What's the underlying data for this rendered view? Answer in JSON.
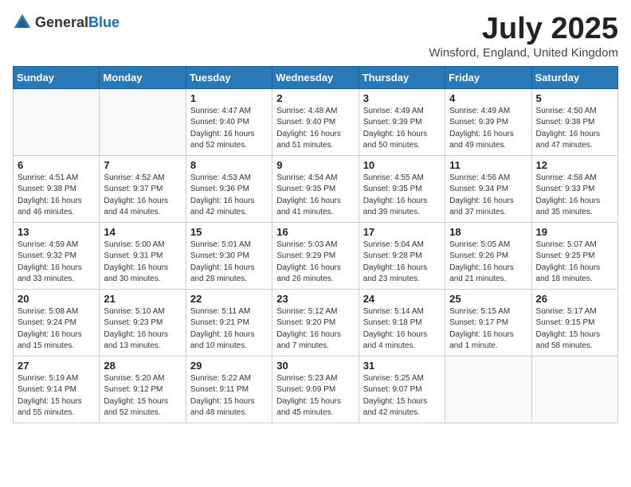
{
  "header": {
    "logo_general": "General",
    "logo_blue": "Blue",
    "title": "July 2025",
    "location": "Winsford, England, United Kingdom"
  },
  "days_of_week": [
    "Sunday",
    "Monday",
    "Tuesday",
    "Wednesday",
    "Thursday",
    "Friday",
    "Saturday"
  ],
  "weeks": [
    [
      {
        "day": "",
        "info": ""
      },
      {
        "day": "",
        "info": ""
      },
      {
        "day": "1",
        "info": "Sunrise: 4:47 AM\nSunset: 9:40 PM\nDaylight: 16 hours and 52 minutes."
      },
      {
        "day": "2",
        "info": "Sunrise: 4:48 AM\nSunset: 9:40 PM\nDaylight: 16 hours and 51 minutes."
      },
      {
        "day": "3",
        "info": "Sunrise: 4:49 AM\nSunset: 9:39 PM\nDaylight: 16 hours and 50 minutes."
      },
      {
        "day": "4",
        "info": "Sunrise: 4:49 AM\nSunset: 9:39 PM\nDaylight: 16 hours and 49 minutes."
      },
      {
        "day": "5",
        "info": "Sunrise: 4:50 AM\nSunset: 9:38 PM\nDaylight: 16 hours and 47 minutes."
      }
    ],
    [
      {
        "day": "6",
        "info": "Sunrise: 4:51 AM\nSunset: 9:38 PM\nDaylight: 16 hours and 46 minutes."
      },
      {
        "day": "7",
        "info": "Sunrise: 4:52 AM\nSunset: 9:37 PM\nDaylight: 16 hours and 44 minutes."
      },
      {
        "day": "8",
        "info": "Sunrise: 4:53 AM\nSunset: 9:36 PM\nDaylight: 16 hours and 42 minutes."
      },
      {
        "day": "9",
        "info": "Sunrise: 4:54 AM\nSunset: 9:35 PM\nDaylight: 16 hours and 41 minutes."
      },
      {
        "day": "10",
        "info": "Sunrise: 4:55 AM\nSunset: 9:35 PM\nDaylight: 16 hours and 39 minutes."
      },
      {
        "day": "11",
        "info": "Sunrise: 4:56 AM\nSunset: 9:34 PM\nDaylight: 16 hours and 37 minutes."
      },
      {
        "day": "12",
        "info": "Sunrise: 4:58 AM\nSunset: 9:33 PM\nDaylight: 16 hours and 35 minutes."
      }
    ],
    [
      {
        "day": "13",
        "info": "Sunrise: 4:59 AM\nSunset: 9:32 PM\nDaylight: 16 hours and 33 minutes."
      },
      {
        "day": "14",
        "info": "Sunrise: 5:00 AM\nSunset: 9:31 PM\nDaylight: 16 hours and 30 minutes."
      },
      {
        "day": "15",
        "info": "Sunrise: 5:01 AM\nSunset: 9:30 PM\nDaylight: 16 hours and 28 minutes."
      },
      {
        "day": "16",
        "info": "Sunrise: 5:03 AM\nSunset: 9:29 PM\nDaylight: 16 hours and 26 minutes."
      },
      {
        "day": "17",
        "info": "Sunrise: 5:04 AM\nSunset: 9:28 PM\nDaylight: 16 hours and 23 minutes."
      },
      {
        "day": "18",
        "info": "Sunrise: 5:05 AM\nSunset: 9:26 PM\nDaylight: 16 hours and 21 minutes."
      },
      {
        "day": "19",
        "info": "Sunrise: 5:07 AM\nSunset: 9:25 PM\nDaylight: 16 hours and 18 minutes."
      }
    ],
    [
      {
        "day": "20",
        "info": "Sunrise: 5:08 AM\nSunset: 9:24 PM\nDaylight: 16 hours and 15 minutes."
      },
      {
        "day": "21",
        "info": "Sunrise: 5:10 AM\nSunset: 9:23 PM\nDaylight: 16 hours and 13 minutes."
      },
      {
        "day": "22",
        "info": "Sunrise: 5:11 AM\nSunset: 9:21 PM\nDaylight: 16 hours and 10 minutes."
      },
      {
        "day": "23",
        "info": "Sunrise: 5:12 AM\nSunset: 9:20 PM\nDaylight: 16 hours and 7 minutes."
      },
      {
        "day": "24",
        "info": "Sunrise: 5:14 AM\nSunset: 9:18 PM\nDaylight: 16 hours and 4 minutes."
      },
      {
        "day": "25",
        "info": "Sunrise: 5:15 AM\nSunset: 9:17 PM\nDaylight: 16 hours and 1 minute."
      },
      {
        "day": "26",
        "info": "Sunrise: 5:17 AM\nSunset: 9:15 PM\nDaylight: 15 hours and 58 minutes."
      }
    ],
    [
      {
        "day": "27",
        "info": "Sunrise: 5:19 AM\nSunset: 9:14 PM\nDaylight: 15 hours and 55 minutes."
      },
      {
        "day": "28",
        "info": "Sunrise: 5:20 AM\nSunset: 9:12 PM\nDaylight: 15 hours and 52 minutes."
      },
      {
        "day": "29",
        "info": "Sunrise: 5:22 AM\nSunset: 9:11 PM\nDaylight: 15 hours and 48 minutes."
      },
      {
        "day": "30",
        "info": "Sunrise: 5:23 AM\nSunset: 9:09 PM\nDaylight: 15 hours and 45 minutes."
      },
      {
        "day": "31",
        "info": "Sunrise: 5:25 AM\nSunset: 9:07 PM\nDaylight: 15 hours and 42 minutes."
      },
      {
        "day": "",
        "info": ""
      },
      {
        "day": "",
        "info": ""
      }
    ]
  ]
}
